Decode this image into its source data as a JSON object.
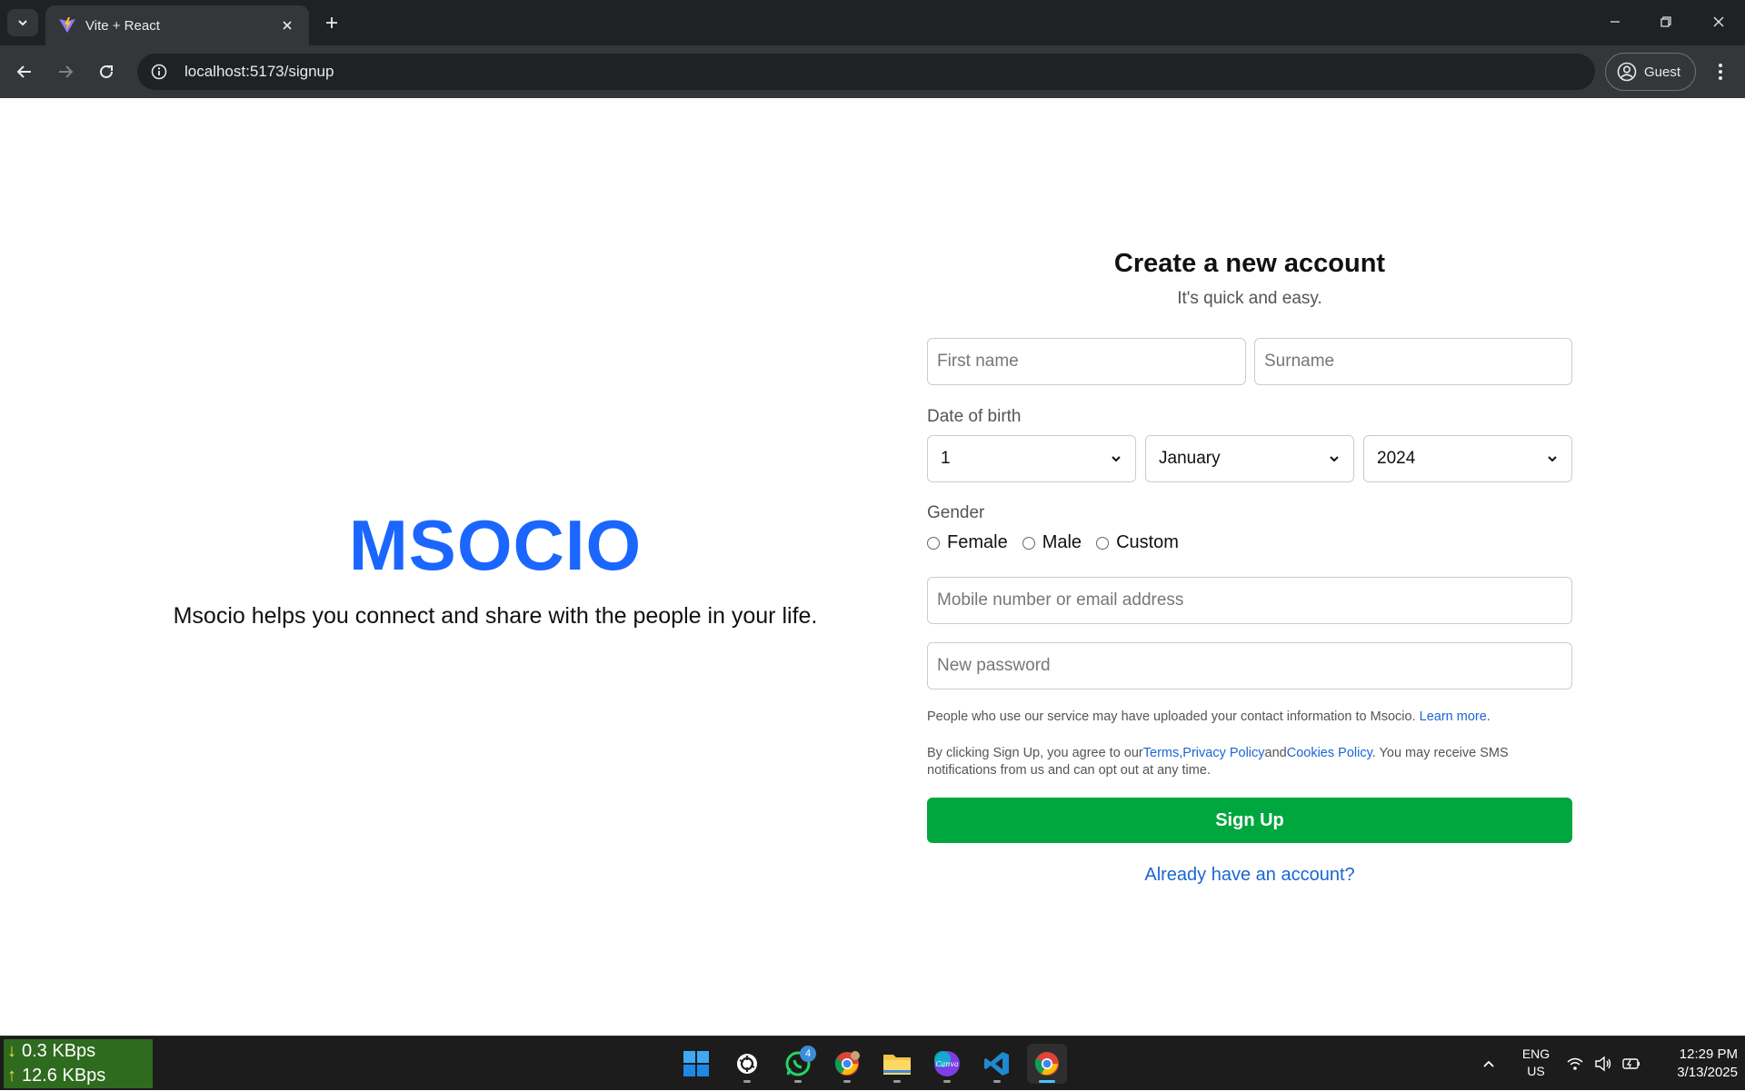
{
  "browser": {
    "tab_title": "Vite + React",
    "url": "localhost:5173/signup",
    "profile_label": "Guest"
  },
  "brand": {
    "name": "MSOCIO",
    "tagline": "Msocio helps you connect and share with the people in your life."
  },
  "form": {
    "title": "Create a new account",
    "subtitle": "It's quick and easy.",
    "first_name_placeholder": "First name",
    "surname_placeholder": "Surname",
    "dob_label": "Date of birth",
    "dob_day": "1",
    "dob_month": "January",
    "dob_year": "2024",
    "gender_label": "Gender",
    "gender_options": [
      "Female",
      "Male",
      "Custom"
    ],
    "contact_placeholder": "Mobile number or email address",
    "password_placeholder": "New password",
    "contact_note": "People who use our service may have uploaded your contact information to Msocio.",
    "learn_more": "Learn more",
    "learn_more_suffix": ".",
    "terms_prefix": "By clicking Sign Up, you agree to our",
    "terms_link": "Terms",
    "terms_sep": ",",
    "privacy_link": "Privacy Policy",
    "and_text": "and",
    "cookies_link": "Cookies Policy",
    "terms_suffix": ". You may receive SMS notifications from us and can opt out at any time.",
    "signup_label": "Sign Up",
    "login_link": "Already have an account?"
  },
  "taskbar": {
    "download_speed": "0.3 KBps",
    "upload_speed": "12.6 KBps",
    "whatsapp_badge": "4",
    "lang_line1": "ENG",
    "lang_line2": "US",
    "time": "12:29 PM",
    "date": "3/13/2025"
  },
  "colors": {
    "brand": "#1a66ff",
    "signup_button": "#00a63e",
    "link": "#1a66d2"
  }
}
